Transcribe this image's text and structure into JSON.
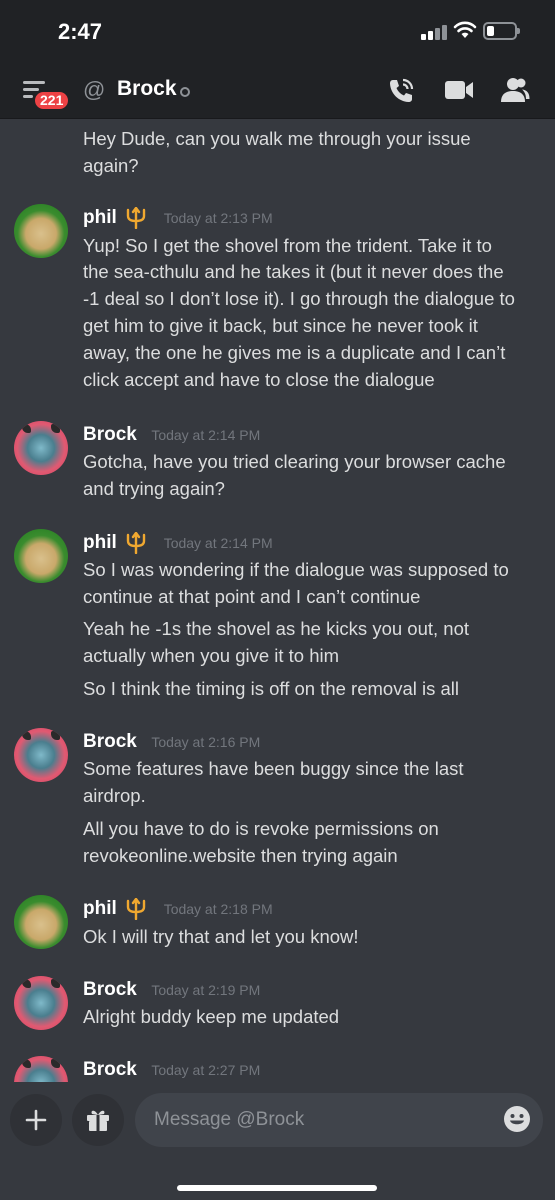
{
  "status_bar": {
    "time": "2:47"
  },
  "header": {
    "badge_count": "221",
    "at_symbol": "@",
    "title": "Brock",
    "icons": [
      "menu-icon",
      "at-icon",
      "call-icon",
      "video-icon",
      "members-icon"
    ]
  },
  "messages": {
    "m0": {
      "lines": [
        "Hey Dude, can you walk me through your issue",
        "again?"
      ]
    },
    "m1": {
      "author": "phil",
      "time": "Today at 2:13 PM",
      "lines": [
        "Yup! So I get the shovel from the trident. Take it to",
        "the sea-cthulu and he takes it (but it never does the",
        "-1 deal so I don’t lose it). I go through the dialogue to",
        "get him to give it back, but since he never took it",
        "away, the one he gives me is a duplicate and I can’t",
        "click accept and have to close the dialogue"
      ]
    },
    "m2": {
      "author": "Brock",
      "time": "Today at 2:14 PM",
      "lines": [
        "Gotcha, have you tried clearing your browser cache",
        "and trying again?"
      ]
    },
    "m3": {
      "author": "phil",
      "time": "Today at 2:14 PM",
      "lines": [
        "So I was wondering if the dialogue was supposed to",
        "continue at that point and I can’t continue",
        "Yeah he -1s the shovel as he kicks you out, not",
        "actually when you give it to him",
        "So I think the timing is off on the removal is all"
      ]
    },
    "m4": {
      "author": "Brock",
      "time": "Today at 2:16 PM",
      "lines": [
        "Some features have been buggy since the last",
        "airdrop.",
        "All you have to do is revoke permissions on",
        "revokeonline.website then trying again"
      ]
    },
    "m5": {
      "author": "phil",
      "time": "Today at 2:18 PM",
      "lines": [
        "Ok I will try that and let you know!"
      ]
    },
    "m6": {
      "author": "Brock",
      "time": "Today at 2:19 PM",
      "lines": [
        "Alright buddy keep me updated"
      ]
    },
    "m7": {
      "author": "Brock",
      "time": "Today at 2:27 PM"
    }
  },
  "composer": {
    "placeholder": "Message @Brock",
    "plus": "+"
  },
  "colors": {
    "background": "#36393f",
    "header": "#202225",
    "badge": "#ed4245",
    "trident": "#f0a830",
    "timestamp": "#72767d"
  }
}
